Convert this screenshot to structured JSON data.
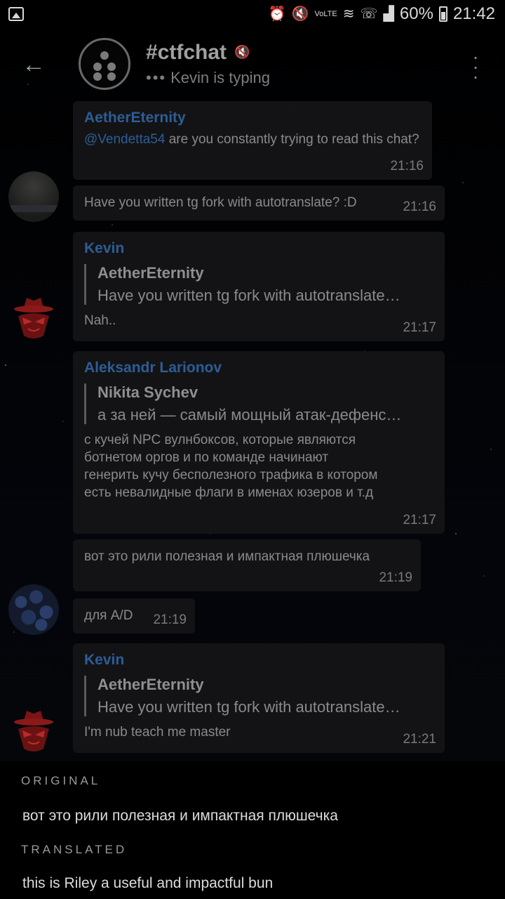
{
  "status_bar": {
    "battery": "60%",
    "time": "21:42",
    "network": "VoLTE"
  },
  "header": {
    "title": "#ctfchat",
    "subtitle": "Kevin is typing",
    "back_icon": "arrow-left-icon",
    "mute_icon": "muted-icon",
    "menu_icon": "more-vert-icon"
  },
  "messages": [
    {
      "sender": "AetherEternity",
      "mention": "@Vendetta54",
      "text": "are you constantly trying to read this chat?",
      "time": "21:16"
    },
    {
      "text": "Have you written tg fork with autotranslate? :D",
      "time": "21:16"
    },
    {
      "sender": "Kevin",
      "reply_name": "AetherEternity",
      "reply_text": "Have you written tg fork with autotranslate…",
      "text": "Nah..",
      "time": "21:17"
    },
    {
      "sender": "Aleksandr Larionov",
      "reply_name": "Nikita Sychev",
      "reply_text": "а за ней — самый мощный атак-дефенс…",
      "lines": [
        "с кучей NPC вулнбоксов, которые являются",
        "ботнетом оргов и по команде начинают",
        "генерить кучу бесполезного трафика в котором",
        "есть невалидные флаги в именах юзеров и т.д"
      ],
      "time": "21:17"
    },
    {
      "text": "вот это рили полезная и импактная плюшечка",
      "time": "21:19"
    },
    {
      "text": "для A/D",
      "time": "21:19"
    },
    {
      "sender": "Kevin",
      "reply_name": "AetherEternity",
      "reply_text": "Have you written tg fork with autotranslate…",
      "text": "I'm nub teach me master",
      "time": "21:21"
    }
  ],
  "translation": {
    "original_label": "ORIGINAL",
    "original_text": "вот это рили полезная и импактная плюшечка",
    "translated_label": "TRANSLATED",
    "translated_text": "this is Riley a useful and impactful bun"
  },
  "colors": {
    "link": "#2d5d95",
    "bubble": "#161618",
    "background": "#000000"
  }
}
